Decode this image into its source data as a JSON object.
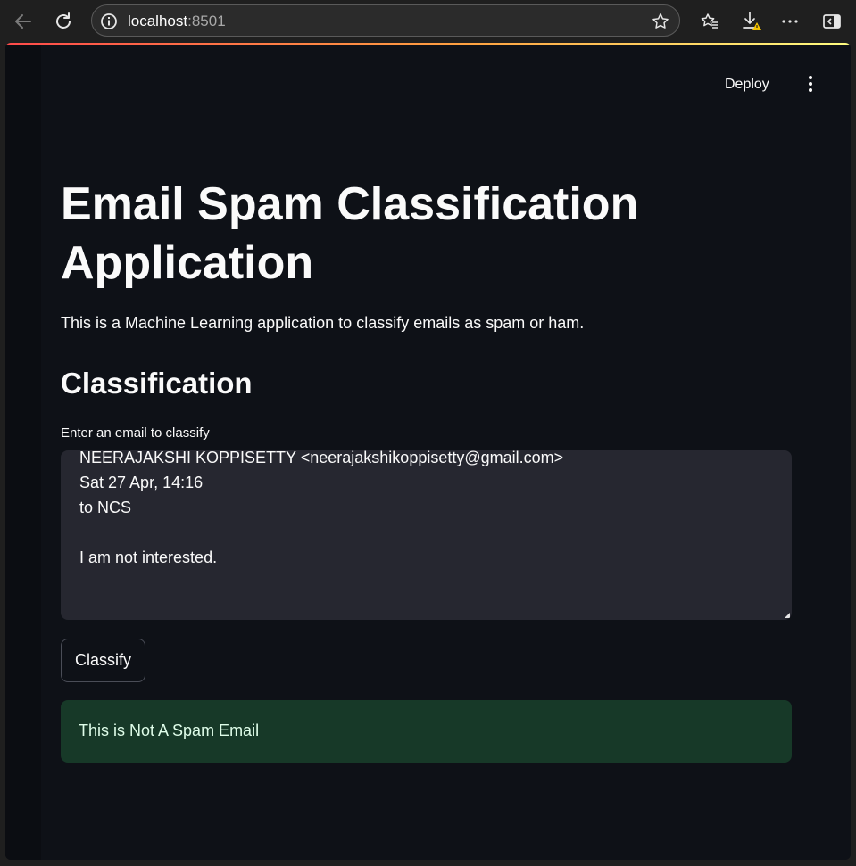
{
  "browser": {
    "url_host": "localhost",
    "url_port": ":8501",
    "icons": [
      "back-arrow-icon",
      "refresh-icon",
      "info-icon",
      "star-icon",
      "favorites-icon",
      "download-warning-icon",
      "more-icon",
      "sidebar-icon"
    ]
  },
  "app": {
    "header": {
      "deploy_label": "Deploy",
      "menu_icon": "vertical-dots-icon"
    },
    "title": "Email Spam Classification Application",
    "subtitle": "This is a Machine Learning application to classify emails as spam or ham.",
    "section_heading": "Classification",
    "input_label": "Enter an email to classify",
    "email_text": "NEERAJAKSHI KOPPISETTY <neerajakshikoppisetty@gmail.com>\nSat 27 Apr, 14:16\nto NCS\n\nI am not interested.",
    "classify_button_label": "Classify",
    "result_message": "This is Not A Spam Email"
  },
  "colors": {
    "app_background": "#0e1117",
    "text": "#fafafa",
    "input_background": "#262730",
    "success_background": "#173928",
    "success_text": "#dffde9"
  }
}
